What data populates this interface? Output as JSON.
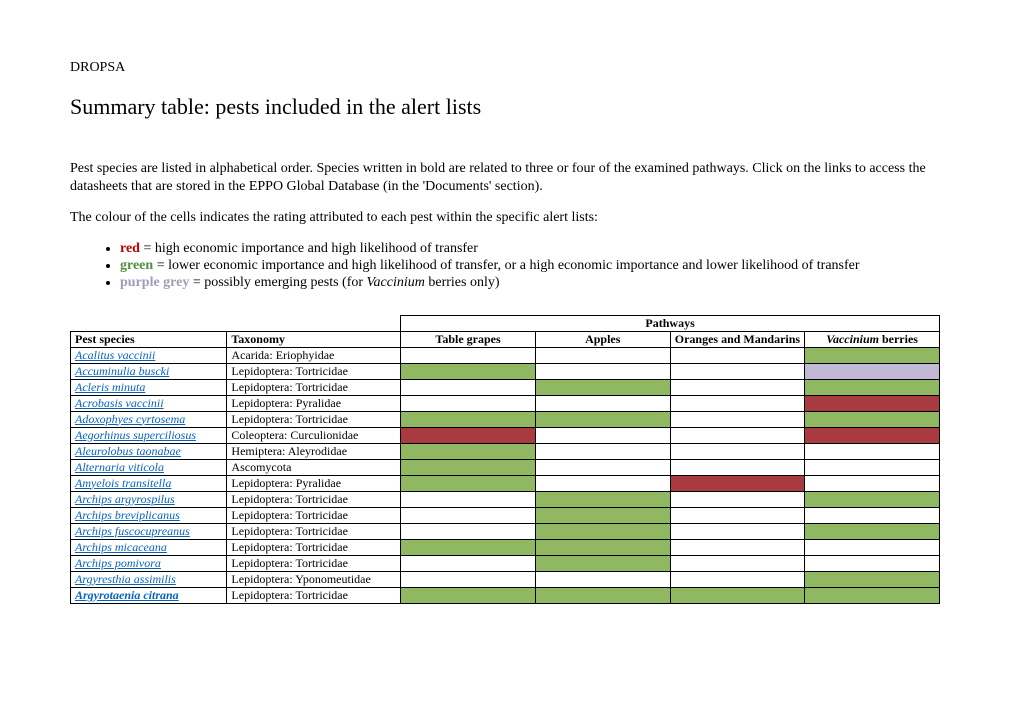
{
  "header_label": "DROPSA",
  "title": "Summary table: pests included in the alert lists",
  "intro_p1": "Pest species are listed in alphabetical order. Species written in bold are related to three or four of the examined pathways. Click on the links to access the datasheets that are stored in the EPPO Global Database (in the 'Documents' section).",
  "intro_p2": "The colour of the cells indicates the rating attributed to each pest within the specific alert lists:",
  "legend": {
    "red_label": "red",
    "red_text": " = high economic importance and high likelihood of transfer",
    "green_label": "green",
    "green_text": " = lower economic importance and high likelihood of transfer, or a high economic importance and lower likelihood of transfer",
    "purple_label": "purple grey",
    "purple_text_a": " = possibly emerging pests (for ",
    "purple_text_b": "Vaccinium",
    "purple_text_c": " berries only)"
  },
  "table_super": "Pathways",
  "headers": {
    "species": "Pest species",
    "taxonomy": "Taxonomy",
    "p1": "Table grapes",
    "p2": "Apples",
    "p3": "Oranges and Mandarins",
    "p4_a": "Vaccinium",
    "p4_b": " berries"
  },
  "rows": [
    {
      "species": "Acalitus vaccinii",
      "tax": "Acarida: Eriophyidae",
      "bold": false,
      "c": [
        "",
        "",
        "",
        "green"
      ]
    },
    {
      "species": "Accuminulia buscki",
      "tax": "Lepidoptera: Tortricidae",
      "bold": false,
      "c": [
        "green",
        "",
        "",
        "purple"
      ]
    },
    {
      "species": "Acleris minuta",
      "tax": "Lepidoptera: Tortricidae",
      "bold": false,
      "c": [
        "",
        "green",
        "",
        "green"
      ]
    },
    {
      "species": "Acrobasis vaccinii",
      "tax": "Lepidoptera: Pyralidae",
      "bold": false,
      "c": [
        "",
        "",
        "",
        "red"
      ]
    },
    {
      "species": "Adoxophyes cyrtosema",
      "tax": "Lepidoptera: Tortricidae",
      "bold": false,
      "c": [
        "green",
        "green",
        "",
        "green"
      ]
    },
    {
      "species": "Aegorhinus superciliosus",
      "tax": "Coleoptera: Curculionidae",
      "bold": false,
      "c": [
        "red",
        "",
        "",
        "red"
      ]
    },
    {
      "species": "Aleurolobus taonabae",
      "tax": "Hemiptera: Aleyrodidae",
      "bold": false,
      "c": [
        "green",
        "",
        "",
        ""
      ]
    },
    {
      "species": "Alternaria viticola",
      "tax": "Ascomycota",
      "bold": false,
      "c": [
        "green",
        "",
        "",
        ""
      ]
    },
    {
      "species": "Amyelois transitella",
      "tax": "Lepidoptera: Pyralidae",
      "bold": false,
      "c": [
        "green",
        "",
        "red",
        ""
      ]
    },
    {
      "species": "Archips argyrospilus",
      "tax": "Lepidoptera: Tortricidae",
      "bold": false,
      "c": [
        "",
        "green",
        "",
        "green"
      ]
    },
    {
      "species": "Archips breviplicanus",
      "tax": "Lepidoptera: Tortricidae",
      "bold": false,
      "c": [
        "",
        "green",
        "",
        ""
      ]
    },
    {
      "species": "Archips fuscocupreanus",
      "tax": "Lepidoptera: Tortricidae",
      "bold": false,
      "c": [
        "",
        "green",
        "",
        "green"
      ]
    },
    {
      "species": "Archips micaceana",
      "tax": "Lepidoptera: Tortricidae",
      "bold": false,
      "c": [
        "green",
        "green",
        "",
        ""
      ]
    },
    {
      "species": "Archips pomivora",
      "tax": "Lepidoptera: Tortricidae",
      "bold": false,
      "c": [
        "",
        "green",
        "",
        ""
      ]
    },
    {
      "species": "Argyresthia assimilis",
      "tax": "Lepidoptera: Yponomeutidae",
      "bold": false,
      "c": [
        "",
        "",
        "",
        "green"
      ]
    },
    {
      "species": "Argyrotaenia citrana",
      "tax": "Lepidoptera: Tortricidae",
      "bold": true,
      "c": [
        "green",
        "green",
        "green",
        "green"
      ]
    }
  ]
}
